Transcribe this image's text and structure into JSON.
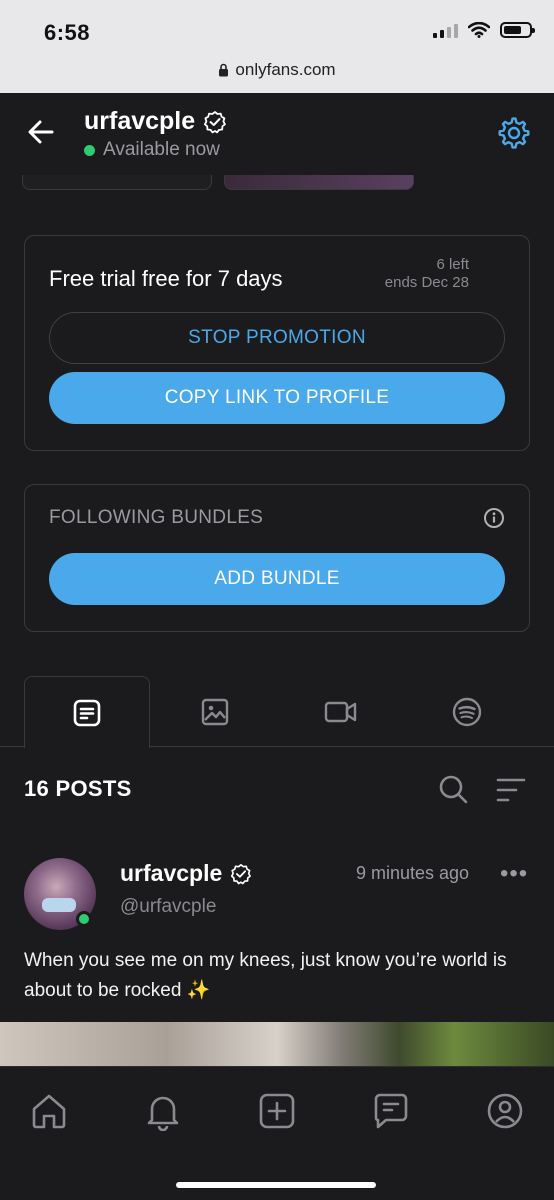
{
  "status_bar": {
    "time": "6:58",
    "url": "onlyfans.com"
  },
  "header": {
    "title": "urfavcple",
    "status": "Available now"
  },
  "trial": {
    "title": "Free trial free for 7 days",
    "left": "6 left",
    "ends": "ends Dec 28",
    "stop_label": "STOP PROMOTION",
    "copy_label": "COPY LINK TO PROFILE"
  },
  "bundles": {
    "title": "FOLLOWING BUNDLES",
    "add_label": "ADD BUNDLE"
  },
  "tabs": [
    {
      "icon": "posts-icon",
      "active": true
    },
    {
      "icon": "image-icon",
      "active": false
    },
    {
      "icon": "video-icon",
      "active": false
    },
    {
      "icon": "spotify-icon",
      "active": false
    }
  ],
  "posts": {
    "count_label": "16 POSTS"
  },
  "post": {
    "name": "urfavcple",
    "handle": "@urfavcple",
    "time": "9 minutes ago",
    "more": "•••",
    "text": "When you see me on my knees, just know you’re world is about to be rocked",
    "emoji": "✨"
  },
  "bottom_nav": [
    "home-icon",
    "bell-icon",
    "add-post-icon",
    "messages-icon",
    "profile-icon"
  ],
  "colors": {
    "accent": "#4aa9ea",
    "background": "#1b1b1d",
    "online": "#2ecc71"
  }
}
